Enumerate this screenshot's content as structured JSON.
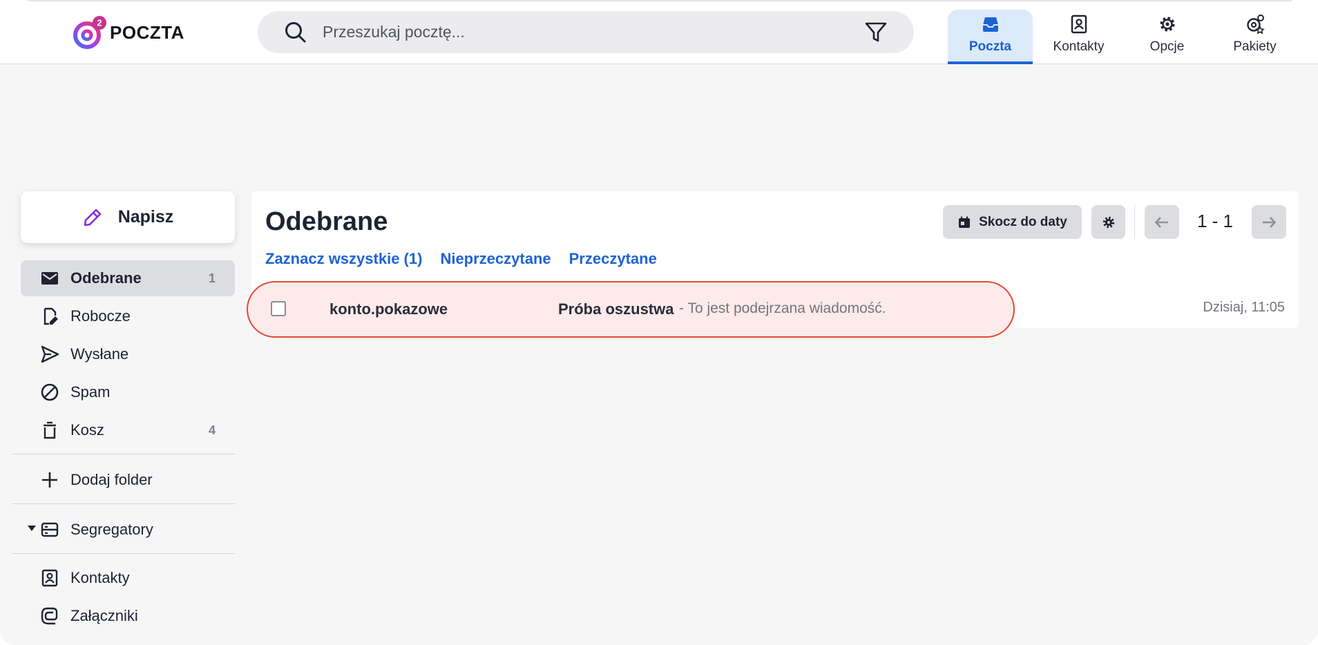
{
  "header": {
    "logo_text": "POCZTA",
    "search_placeholder": "Przeszukaj pocztę...",
    "nav_tabs": [
      {
        "label": "Poczta",
        "icon": "inbox-icon",
        "active": true
      },
      {
        "label": "Kontakty",
        "icon": "contacts-icon",
        "active": false
      },
      {
        "label": "Opcje",
        "icon": "gear-icon",
        "active": false
      },
      {
        "label": "Pakiety",
        "icon": "packages-icon",
        "active": false
      }
    ]
  },
  "sidebar": {
    "compose_label": "Napisz",
    "folders": [
      {
        "label": "Odebrane",
        "count": "1",
        "icon": "envelope-icon",
        "active": true
      },
      {
        "label": "Robocze",
        "count": "",
        "icon": "draft-icon",
        "active": false
      },
      {
        "label": "Wysłane",
        "count": "",
        "icon": "send-icon",
        "active": false
      },
      {
        "label": "Spam",
        "count": "",
        "icon": "spam-icon",
        "active": false
      },
      {
        "label": "Kosz",
        "count": "4",
        "icon": "trash-icon",
        "active": false
      }
    ],
    "add_folder_label": "Dodaj folder",
    "segregators_label": "Segregatory",
    "links": [
      {
        "label": "Kontakty",
        "icon": "contacts-icon"
      },
      {
        "label": "Załączniki",
        "icon": "attachment-icon"
      }
    ]
  },
  "main": {
    "folder_title": "Odebrane",
    "filters": {
      "select_all": "Zaznacz wszystkie (1)",
      "unread": "Nieprzeczytane",
      "read": "Przeczytane"
    },
    "jump_to_date_label": "Skocz do daty",
    "pager_text": "1 - 1",
    "messages": [
      {
        "sender": "konto.pokazowe",
        "subject": "Próba oszustwa",
        "preview": " - To jest podejrzana wiadomość.",
        "date": "Dzisiaj, 11:05",
        "flag_color": "#e34a2e"
      }
    ]
  },
  "colors": {
    "accent": "#1e63d6",
    "active_tab_bg": "#dbeaf9",
    "suspicious_bg": "#fdeaea",
    "suspicious_border": "#e34a2e",
    "compose_icon": "#8a2be2"
  }
}
